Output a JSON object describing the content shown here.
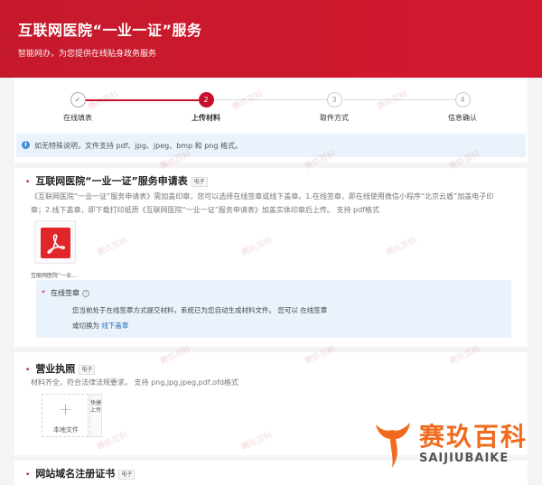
{
  "header": {
    "title": "互联网医院“一业一证”服务",
    "subtitle": "智能网办，为您提供在线贴身政务服务"
  },
  "steps": [
    {
      "label": "在线填表",
      "number": "✓",
      "state": "done"
    },
    {
      "label": "上传材料",
      "number": "2",
      "state": "active"
    },
    {
      "label": "取件方式",
      "number": "3",
      "state": "todo"
    },
    {
      "label": "信息确认",
      "number": "4",
      "state": "todo"
    }
  ],
  "notice": {
    "icon": "info-icon",
    "text": "如无特殊说明，文件支持 pdf、jpg、jpeg、bmp 和 png 格式。"
  },
  "section1": {
    "title": "互联网医院“一业一证”服务申请表",
    "tag": "电子",
    "desc_line1": "《互联网医院“一业一证”服务申请表》需加盖印章，您可以选择在线签章或线下盖章。1.在线签章，即在线使用微信小程序“北京云盾”加盖电子印",
    "desc_line2": "章；2.线下盖章，即下载打印纸质《互联网医院“一业一证”服务申请表》加盖实体印章后上传。   支持 pdf格式",
    "file_name": "互联网医院“一业...",
    "sign": {
      "label": "在线签章",
      "line2": "您当前处于在线签章方式提交材料，系统已为您自动生成材料文件。 您可以 在线签章",
      "line3_prefix": "或切换为",
      "line3_link": "线下盖章"
    }
  },
  "section2": {
    "title": "营业执照",
    "tag": "电子",
    "desc": "材料齐全，符合法律法规要求。    支持 png,jpg,jpeg,pdf,ofd格式",
    "upload_label": "本地文件",
    "quick_label": "快捷上传"
  },
  "section3": {
    "title": "网站域名注册证书",
    "tag": "电子"
  },
  "watermark_text": "赛玖百科",
  "brand": {
    "name": "赛玖百科",
    "pinyin": "SAIJIUBAIKE"
  },
  "colors": {
    "header_red": "#c8102e",
    "info_blue": "#eaf3fb",
    "brand_orange": "#f06a1d"
  }
}
